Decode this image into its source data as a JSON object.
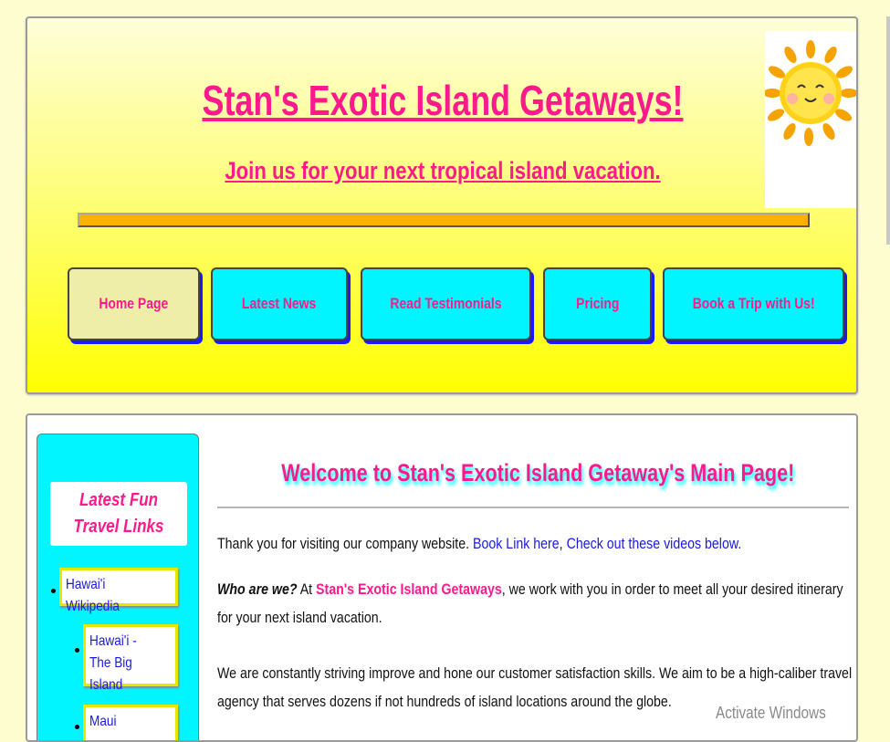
{
  "header": {
    "title": "Stan's Exotic Island Getaways!",
    "tagline": "Join us for your next tropical island vacation."
  },
  "nav": [
    {
      "label": "Home Page",
      "active": true
    },
    {
      "label": "Latest News",
      "active": false
    },
    {
      "label": "Read Testimonials",
      "active": false
    },
    {
      "label": "Pricing",
      "active": false
    },
    {
      "label": "Book a Trip with Us!",
      "active": false
    }
  ],
  "sidebar": {
    "title": "Latest Fun Travel Links",
    "links": [
      "Hawai'i Wikipedia",
      "Hawai'i - The Big Island",
      "Maui"
    ]
  },
  "main": {
    "heading": "Welcome to Stan's Exotic Island Getaway's Main Page!",
    "p1_text": "Thank you for visiting our company website.",
    "p1_link1": "Book Link here",
    "p1_comma": ",",
    "p1_link2": "Check out these videos below.",
    "p2_lead": "Who are we?",
    "p2_at": "At",
    "p2_company": "Stan's Exotic Island Getaways",
    "p2_rest": ", we work with you in order to meet all your desired itinerary for your next island vacation.",
    "p3": "We are constantly striving improve and hone our customer satisfaction skills. We aim to be a high-caliber travel agency that serves dozens if not hundreds of island locations around the globe."
  },
  "os_watermark": "Activate Windows",
  "colors": {
    "accent_pink": "#ff1a8c",
    "button_cyan": "#00f5ff",
    "header_yellow": "#ffff00",
    "divider_orange": "#ffb000",
    "link_blue": "#1a1add"
  }
}
